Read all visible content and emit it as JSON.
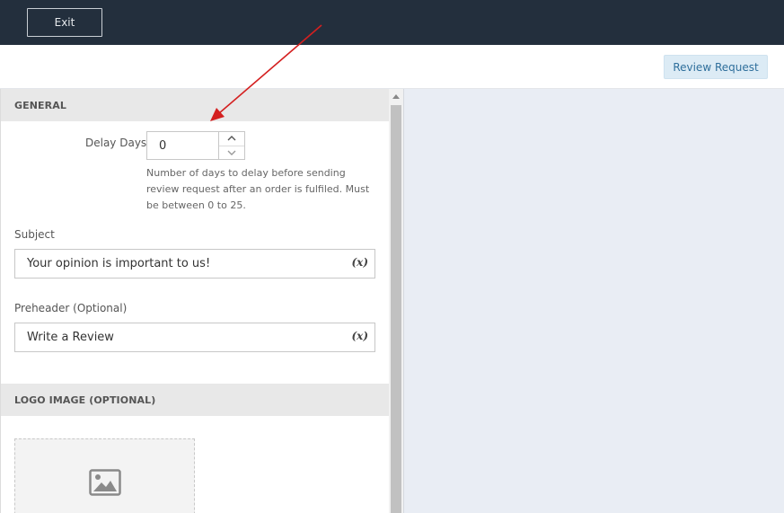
{
  "topbar": {
    "exit_label": "Exit"
  },
  "toolbar": {
    "review_request_label": "Review Request"
  },
  "general": {
    "header": "GENERAL",
    "delay_days_label": "Delay Days",
    "delay_days_value": "0",
    "delay_help": "Number of days to delay before sending review request after an order is fulfiled. Must be between 0 to 25.",
    "subject_label": "Subject",
    "subject_value": "Your opinion is important to us!",
    "preheader_label": "Preheader (Optional)",
    "preheader_value": "Write a Review",
    "variable_icon": "(x)"
  },
  "logo": {
    "header": "LOGO IMAGE (OPTIONAL)",
    "icon": "image-icon"
  },
  "colors": {
    "topbar": "#232f3d",
    "accent_button_bg": "#dcebf5",
    "accent_button_text": "#2f6f9c",
    "section_header_bg": "#e8e8e8",
    "preview_bg": "#e9edf4",
    "annotation_arrow": "#d42020"
  }
}
